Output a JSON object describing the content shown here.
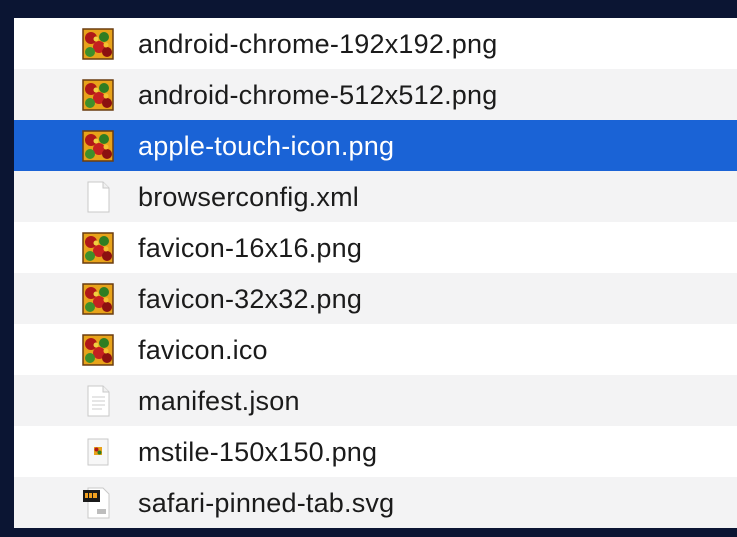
{
  "files": [
    {
      "name": "android-chrome-192x192.png",
      "icon": "png-favicon-icon"
    },
    {
      "name": "android-chrome-512x512.png",
      "icon": "png-favicon-icon"
    },
    {
      "name": "apple-touch-icon.png",
      "icon": "png-favicon-icon",
      "selected": true
    },
    {
      "name": "browserconfig.xml",
      "icon": "blank-document-icon"
    },
    {
      "name": "favicon-16x16.png",
      "icon": "png-favicon-icon"
    },
    {
      "name": "favicon-32x32.png",
      "icon": "png-favicon-icon"
    },
    {
      "name": "favicon.ico",
      "icon": "png-favicon-icon"
    },
    {
      "name": "manifest.json",
      "icon": "text-document-icon"
    },
    {
      "name": "mstile-150x150.png",
      "icon": "small-tile-image-icon"
    },
    {
      "name": "safari-pinned-tab.svg",
      "icon": "svg-document-icon"
    }
  ],
  "colors": {
    "background": "#0b1533",
    "selection": "#1a63d6",
    "alternate_row": "#f3f3f4"
  }
}
